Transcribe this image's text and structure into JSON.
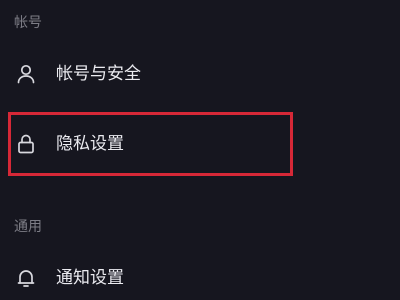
{
  "sections": [
    {
      "header": "帐号",
      "items": [
        {
          "label": "帐号与安全",
          "icon": "person-icon"
        },
        {
          "label": "隐私设置",
          "icon": "lock-icon",
          "highlighted": true
        }
      ]
    },
    {
      "header": "通用",
      "items": [
        {
          "label": "通知设置",
          "icon": "bell-icon"
        }
      ]
    }
  ],
  "colors": {
    "background": "#16161f",
    "text": "#ebebf0",
    "section_header": "#7d7d86",
    "highlight": "#d62837"
  }
}
